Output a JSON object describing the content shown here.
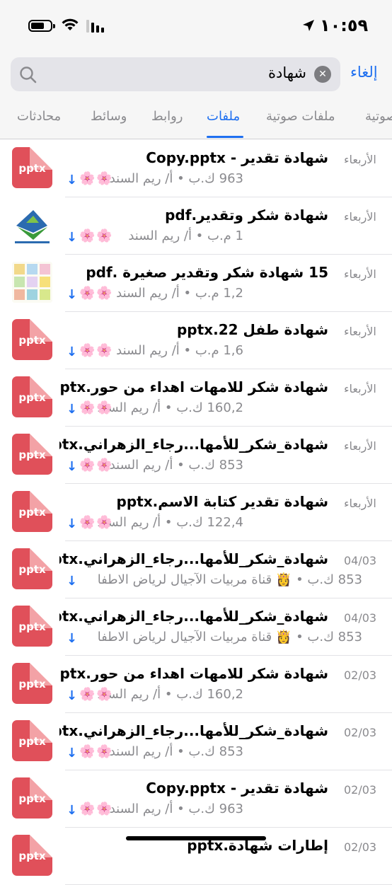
{
  "status": {
    "time": "١٠:٥٩"
  },
  "search": {
    "query": "شهادة",
    "cancel_label": "إلغاء"
  },
  "tabs": [
    {
      "label": "محادثات"
    },
    {
      "label": "وسائط"
    },
    {
      "label": "روابط"
    },
    {
      "label": "ملفات",
      "active": true
    },
    {
      "label": "ملفات صوتية"
    },
    {
      "label": "صوتية"
    }
  ],
  "files": [
    {
      "title": "شهادة تقدير - Copy.pptx",
      "date": "الأربعاء",
      "meta": "963 ك.ب • أ/ ريم السند",
      "icon": "pptx",
      "emoji": "🌸🌸"
    },
    {
      "title": "شهادة شكر وتقدير.pdf",
      "date": "الأربعاء",
      "meta": "1 م.ب • أ/ ريم السند",
      "icon": "image-logo",
      "emoji": "🌸🌸"
    },
    {
      "title": "15 شهادة شكر وتقدير صغيرة .pdf",
      "date": "الأربعاء",
      "meta": "1,2 م.ب • أ/ ريم السند",
      "icon": "image-collage",
      "emoji": "🌸🌸"
    },
    {
      "title": "شهادة طفل 22.pptx",
      "date": "الأربعاء",
      "meta": "1,6 م.ب • أ/ ريم السند",
      "icon": "pptx",
      "emoji": "🌸🌸"
    },
    {
      "title": "شهادة شكر للامهات اهداء من حور.pptx",
      "date": "الأربعاء",
      "meta": "160,2 ك.ب • أ/ ريم السند",
      "icon": "pptx",
      "emoji": "🌸🌸"
    },
    {
      "title": "شهادة_شكر_للأمها...رجاء_الزهراني.pptx",
      "date": "الأربعاء",
      "meta": "853 ك.ب • أ/ ريم السند",
      "icon": "pptx",
      "emoji": "🌸🌸"
    },
    {
      "title": "شهادة تقدير كتابة الاسم.pptx",
      "date": "الأربعاء",
      "meta": "122,4 ك.ب • أ/ ريم السند",
      "icon": "pptx",
      "emoji": "🌸🌸"
    },
    {
      "title": "شهادة_شكر_للأمها...رجاء_الزهراني.pptx",
      "date": "04/03",
      "meta": "853 ك.ب • 👸 قناة مربيات الآجيال لرياض الاطفا",
      "icon": "pptx",
      "emoji": ""
    },
    {
      "title": "شهادة_شكر_للأمها...رجاء_الزهراني.pptx",
      "date": "04/03",
      "meta": "853 ك.ب • 👸 قناة مربيات الآجيال لرياض الاطفا",
      "icon": "pptx",
      "emoji": ""
    },
    {
      "title": "شهادة شكر للامهات اهداء من حور.pptx",
      "date": "02/03",
      "meta": "160,2 ك.ب • أ/ ريم السند",
      "icon": "pptx",
      "emoji": "🌸🌸"
    },
    {
      "title": "شهادة_شكر_للأمها...رجاء_الزهراني.pptx",
      "date": "02/03",
      "meta": "853 ك.ب • أ/ ريم السند",
      "icon": "pptx",
      "emoji": "🌸🌸"
    },
    {
      "title": "شهادة تقدير - Copy.pptx",
      "date": "02/03",
      "meta": "963 ك.ب • أ/ ريم السند",
      "icon": "pptx",
      "emoji": "🌸🌸"
    },
    {
      "title": "إطارات شهادة.pptx",
      "date": "02/03",
      "meta": "",
      "icon": "pptx",
      "emoji": ""
    }
  ],
  "icon_label": "pptx",
  "colors": {
    "accent": "#1e6ff0",
    "pptx": "#e0505a",
    "muted": "#8a8a8e"
  }
}
